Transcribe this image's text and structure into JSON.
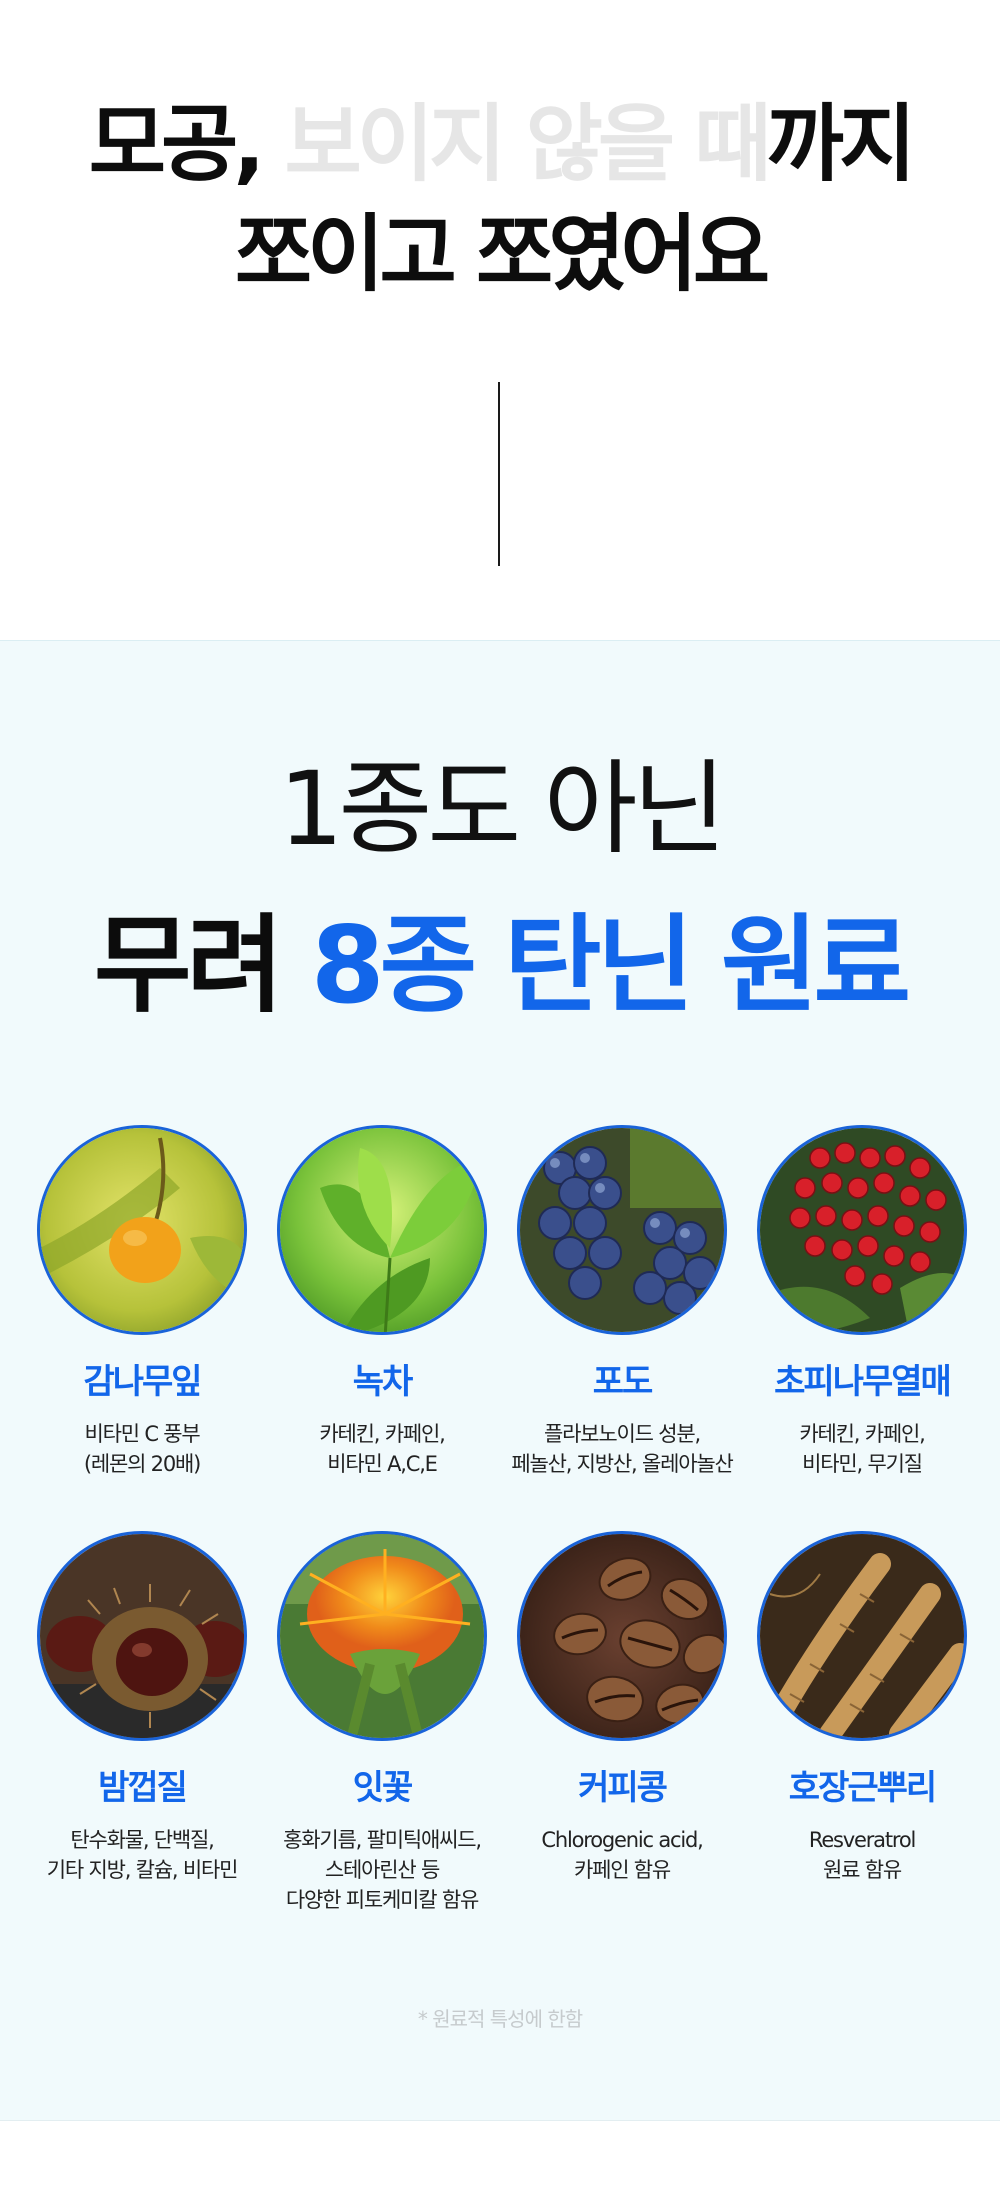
{
  "hero": {
    "line1_dark": "모공,",
    "line1_faded": " 보이지 않을 때",
    "line1_end": "까지",
    "line2": "쪼이고 쪼였어요"
  },
  "section": {
    "title1": "1종도 아닌",
    "title2_dark": "무려 ",
    "title2_blue": "8종 탄닌 원료"
  },
  "ingredients": [
    {
      "name": "감나무잎",
      "desc_line1": "비타민 C 풍부",
      "desc_line2": "(레몬의 20배)",
      "desc_line3": "",
      "icon": "persimmon-leaf-image"
    },
    {
      "name": "녹차",
      "desc_line1": "카테킨, 카페인,",
      "desc_line2": "비타민 A,C,E",
      "desc_line3": "",
      "icon": "green-tea-image"
    },
    {
      "name": "포도",
      "desc_line1": "플라보노이드 성분,",
      "desc_line2": "페놀산, 지방산, 올레아놀산",
      "desc_line3": "",
      "icon": "grape-image"
    },
    {
      "name": "초피나무열매",
      "desc_line1": "카테킨, 카페인,",
      "desc_line2": "비타민, 무기질",
      "desc_line3": "",
      "icon": "prickly-ash-berry-image"
    },
    {
      "name": "밤껍질",
      "desc_line1": "탄수화물, 단백질,",
      "desc_line2": "기타 지방, 칼슘, 비타민",
      "desc_line3": "",
      "icon": "chestnut-image"
    },
    {
      "name": "잇꽃",
      "desc_line1": "홍화기름, 팔미틱애씨드,",
      "desc_line2": "스테아린산 등",
      "desc_line3": "다양한 피토케미칼 함유",
      "icon": "safflower-image"
    },
    {
      "name": "커피콩",
      "desc_line1": "Chlorogenic acid,",
      "desc_line2": "카페인 함유",
      "desc_line3": "",
      "icon": "coffee-bean-image"
    },
    {
      "name": "호장근뿌리",
      "desc_line1": "Resveratrol",
      "desc_line2": "원료 함유",
      "desc_line3": "",
      "icon": "root-image"
    }
  ],
  "note": "* 원료적 특성에 한함",
  "colors": {
    "accent": "#1266ea",
    "section_bg": "#f1fafc",
    "circle_border": "#1a63d8"
  }
}
